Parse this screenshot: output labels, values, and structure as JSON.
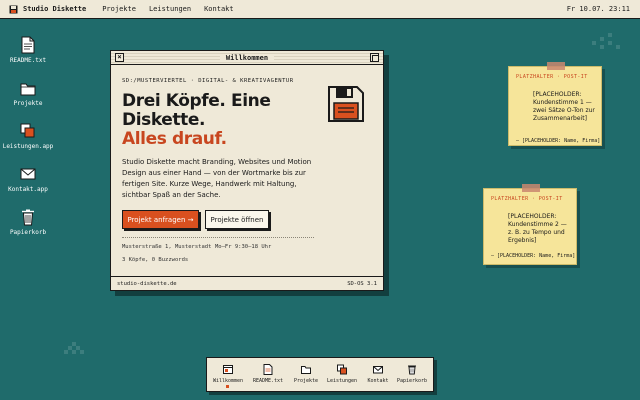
{
  "menubar": {
    "brand": "Studio Diskette",
    "items": [
      "Projekte",
      "Leistungen",
      "Kontakt"
    ],
    "clock": "Fr 10.07. 23:11"
  },
  "desktop_icons": [
    {
      "label": "README.txt",
      "icon": "document-icon"
    },
    {
      "label": "Projekte",
      "icon": "folder-icon"
    },
    {
      "label": "Leistungen.app",
      "icon": "stacked-windows-icon"
    },
    {
      "label": "Kontakt.app",
      "icon": "envelope-icon"
    },
    {
      "label": "Papierkorb",
      "icon": "trash-icon"
    }
  ],
  "window": {
    "title": "Willkommen",
    "close_glyph": "×",
    "kicker": "SD:/MUSTERVIERTEL · DIGITAL- & KREATIVAGENTUR",
    "headline_line1": "Drei Köpfe. Eine",
    "headline_line2": "Diskette.",
    "headline_accent": "Alles drauf.",
    "description": "Studio Diskette macht Branding, Websites und Motion Design aus einer Hand — von der Wortmarke bis zur fertigen Site. Kurze Wege, Handwerk mit Haltung, sichtbar Spaß an der Sache.",
    "primary_button": "Projekt anfragen →",
    "secondary_button": "Projekte öffnen",
    "address": "Musterstraße 1, Musterstadt",
    "hours": "Mo–Fr 9:30–18 Uhr",
    "team": "3 Köpfe, 0 Buzzwords",
    "status_left": "studio-diskette.de",
    "status_right": "SD-OS 3.1"
  },
  "notes": [
    {
      "tag": "PLATZHALTER · POST-IT",
      "quote": "[PLACEHOLDER: Kundenstimme 1 — zwei Sätze O-Ton zur Zusammenarbeit]",
      "author": "— [PLACEHOLDER: Name, Firma]"
    },
    {
      "tag": "PLATZHALTER · POST-IT",
      "quote": "[PLACEHOLDER: Kundenstimme 2 — z. B. zu Tempo und Ergebnis]",
      "author": "— [PLACEHOLDER: Name, Firma]"
    }
  ],
  "dock": [
    {
      "label": "Willkommen",
      "icon": "window-icon",
      "active": true
    },
    {
      "label": "README.txt",
      "icon": "document-icon"
    },
    {
      "label": "Projekte",
      "icon": "folder-icon"
    },
    {
      "label": "Leistungen",
      "icon": "stacked-windows-icon"
    },
    {
      "label": "Kontakt",
      "icon": "envelope-icon"
    },
    {
      "label": "Papierkorb",
      "icon": "trash-icon"
    }
  ],
  "colors": {
    "desktop": "#1f6b6b",
    "paper": "#efe9d8",
    "accent": "#d9501f",
    "note": "#f6e59a"
  }
}
